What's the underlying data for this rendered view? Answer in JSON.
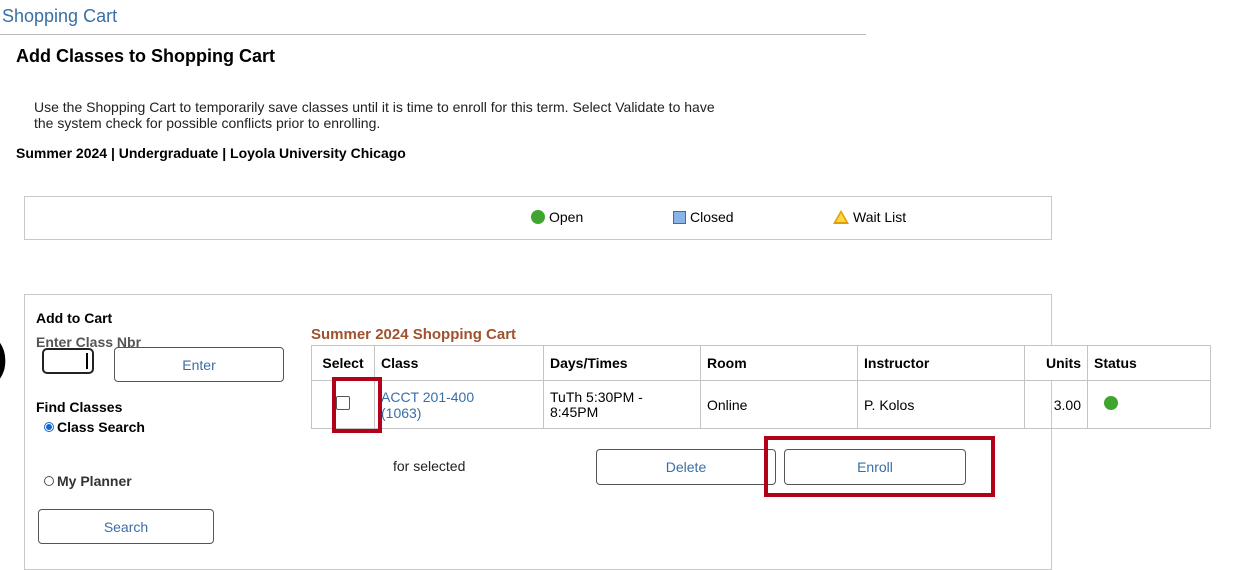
{
  "breadcrumb": "Shopping Cart",
  "page_title": "Add Classes to Shopping Cart",
  "instructions": "Use the Shopping Cart to temporarily save classes until it is time to enroll for this term.  Select Validate to have the system check for possible conflicts prior to enrolling.",
  "term_line": "Summer 2024 | Undergraduate | Loyola University Chicago",
  "legend": {
    "open": "Open",
    "closed": "Closed",
    "wait_list": "Wait List"
  },
  "add_panel": {
    "title": "Add to Cart",
    "enter_class_nbr": "Enter Class Nbr",
    "enter_button": "Enter",
    "class_nbr_value": "",
    "find_classes": "Find Classes",
    "radio_class_search": "Class Search",
    "radio_my_planner": "My Planner",
    "selected_option": "Class Search",
    "search_button": "Search"
  },
  "cart": {
    "title": "Summer 2024 Shopping Cart",
    "headers": {
      "select": "Select",
      "class": "Class",
      "days_times": "Days/Times",
      "room": "Room",
      "instructor": "Instructor",
      "units": "Units",
      "status": "Status"
    },
    "rows": [
      {
        "class_line1": "ACCT 201-400",
        "class_line2": "(1063)",
        "days_line1": "TuTh 5:30PM -",
        "days_line2": "8:45PM",
        "room": "Online",
        "instructor": "P. Kolos",
        "units": "3.00",
        "status": "Open",
        "selected": false
      }
    ],
    "for_selected": "for selected",
    "delete_button": "Delete",
    "enroll_button": "Enroll"
  },
  "colors": {
    "link": "#3a6ea5",
    "cart_title": "#a0522d",
    "open_green": "#3fa52f",
    "highlight_red": "#b3001b"
  }
}
